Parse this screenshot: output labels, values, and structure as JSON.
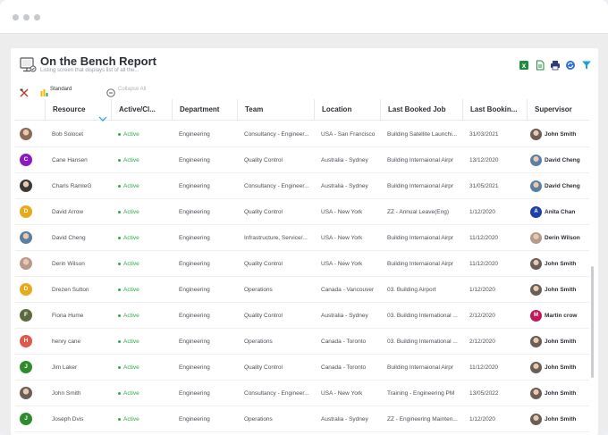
{
  "report": {
    "title": "On the Bench Report",
    "subtitle": "Listing screen that displays list of all the..."
  },
  "toolbar": {
    "icons": [
      "excel-export-icon",
      "document-export-icon",
      "print-icon",
      "sync-icon",
      "filter-icon"
    ],
    "standard_label": "Standard",
    "collapse_label": "Collapse All"
  },
  "columns": [
    "Resource",
    "Active/Cl...",
    "Department",
    "Team",
    "Location",
    "Last Booked Job",
    "Last Bookin...",
    "Supervisor"
  ],
  "colors": {
    "active": "#2ea84a",
    "accent": "#1aa1d8"
  },
  "rows": [
    {
      "resource": "Bob Solocet",
      "avatar": "photo",
      "avatar_color": "#8a6a58",
      "initial": "",
      "status": "Active",
      "department": "Engineering",
      "team": "Consultancy - Engineer...",
      "location": "USA - San Francisco",
      "last_job": "Building Satellite Launchi...",
      "last_date": "31/03/2021",
      "supervisor": "John Smith",
      "sup_avatar": "photo",
      "sup_color": "#6b5e57",
      "sup_initial": ""
    },
    {
      "resource": "Cane Hansen",
      "avatar": "initial",
      "avatar_color": "#8e1bbf",
      "initial": "C",
      "status": "Active",
      "department": "Engineering",
      "team": "Quality Control",
      "location": "Australia - Sydney",
      "last_job": "Building Internaional Airpr",
      "last_date": "13/12/2020",
      "supervisor": "David Cheng",
      "sup_avatar": "photo",
      "sup_color": "#5a7fa3",
      "sup_initial": ""
    },
    {
      "resource": "Charls RamleG",
      "avatar": "photo",
      "avatar_color": "#3c3836",
      "initial": "",
      "status": "Active",
      "department": "Engineering",
      "team": "Consultancy - Engineer...",
      "location": "Australia - Sydney",
      "last_job": "Building Internaional Airpr",
      "last_date": "31/05/2021",
      "supervisor": "David Cheng",
      "sup_avatar": "photo",
      "sup_color": "#5a7fa3",
      "sup_initial": ""
    },
    {
      "resource": "David Arrow",
      "avatar": "initial",
      "avatar_color": "#e8a91a",
      "initial": "D",
      "status": "Active",
      "department": "Engineering",
      "team": "Quality Control",
      "location": "USA - New York",
      "last_job": "ZZ - Annual Leave(Eng)",
      "last_date": "1/12/2020",
      "supervisor": "Anita Chan",
      "sup_avatar": "initial",
      "sup_color": "#1c3fa8",
      "sup_initial": "A"
    },
    {
      "resource": "David Cheng",
      "avatar": "photo",
      "avatar_color": "#5a7fa3",
      "initial": "",
      "status": "Active",
      "department": "Engineering",
      "team": "Infrastructure, Service/...",
      "location": "USA - New York",
      "last_job": "Building Internaional Airpr",
      "last_date": "11/12/2020",
      "supervisor": "Derin Wilson",
      "sup_avatar": "photo",
      "sup_color": "#b89a8a",
      "sup_initial": ""
    },
    {
      "resource": "Derin Wilson",
      "avatar": "photo",
      "avatar_color": "#b89a8a",
      "initial": "",
      "status": "Active",
      "department": "Engineering",
      "team": "Quality Control",
      "location": "USA - New York",
      "last_job": "Building Internaional Airpr",
      "last_date": "11/12/2020",
      "supervisor": "John Smith",
      "sup_avatar": "photo",
      "sup_color": "#6b5e57",
      "sup_initial": ""
    },
    {
      "resource": "Drezen Sutton",
      "avatar": "initial",
      "avatar_color": "#e8a91a",
      "initial": "D",
      "status": "Active",
      "department": "Engineering",
      "team": "Operations",
      "location": "Canada - Vancouver",
      "last_job": "03. Building Airport",
      "last_date": "1/12/2020",
      "supervisor": "John Smith",
      "sup_avatar": "photo",
      "sup_color": "#6b5e57",
      "sup_initial": ""
    },
    {
      "resource": "Fiona Hume",
      "avatar": "initial",
      "avatar_color": "#5c6b3c",
      "initial": "F",
      "status": "Active",
      "department": "Engineering",
      "team": "Quality Control",
      "location": "Australia - Sydney",
      "last_job": "03. Building International ...",
      "last_date": "2/12/2020",
      "supervisor": "Martin crow",
      "sup_avatar": "initial",
      "sup_color": "#c2185b",
      "sup_initial": "M"
    },
    {
      "resource": "henry cane",
      "avatar": "initial",
      "avatar_color": "#e0584a",
      "initial": "H",
      "status": "Active",
      "department": "Engineering",
      "team": "Operations",
      "location": "Canada - Toronto",
      "last_job": "03. Building International ...",
      "last_date": "2/12/2020",
      "supervisor": "John Smith",
      "sup_avatar": "photo",
      "sup_color": "#6b5e57",
      "sup_initial": ""
    },
    {
      "resource": "Jim Laker",
      "avatar": "initial",
      "avatar_color": "#2e8b2e",
      "initial": "J",
      "status": "Active",
      "department": "Engineering",
      "team": "Quality Control",
      "location": "Canada - Toronto",
      "last_job": "Building Internaional Airpr",
      "last_date": "11/12/2020",
      "supervisor": "John Smith",
      "sup_avatar": "photo",
      "sup_color": "#6b5e57",
      "sup_initial": ""
    },
    {
      "resource": "John Smith",
      "avatar": "photo",
      "avatar_color": "#6b5e57",
      "initial": "",
      "status": "Active",
      "department": "Engineering",
      "team": "Consultancy - Engineer...",
      "location": "USA - New York",
      "last_job": "Training - Engineering PM",
      "last_date": "13/05/2022",
      "supervisor": "John Smith",
      "sup_avatar": "photo",
      "sup_color": "#6b5e57",
      "sup_initial": ""
    },
    {
      "resource": "Joseph Dvis",
      "avatar": "initial",
      "avatar_color": "#2e8b2e",
      "initial": "J",
      "status": "Active",
      "department": "Engineering",
      "team": "Operations",
      "location": "Australia - Sydney",
      "last_job": "ZZ - Engineering Mainten...",
      "last_date": "1/12/2020",
      "supervisor": "John Smith",
      "sup_avatar": "photo",
      "sup_color": "#6b5e57",
      "sup_initial": ""
    }
  ]
}
